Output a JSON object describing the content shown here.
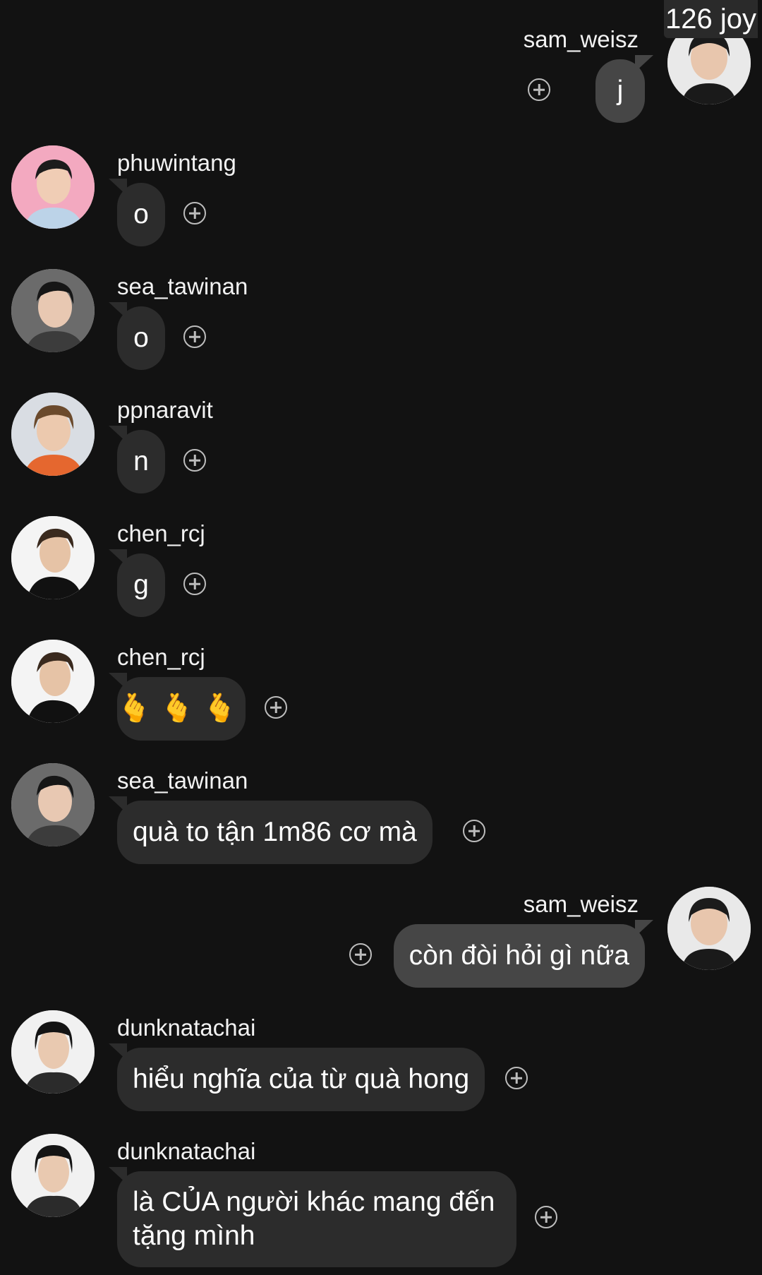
{
  "badge": "126 joy",
  "messages": [
    {
      "user": "sam_weisz",
      "text": "j",
      "side": "right"
    },
    {
      "user": "phuwintang",
      "text": "o",
      "side": "left"
    },
    {
      "user": "sea_tawinan",
      "text": "o",
      "side": "left"
    },
    {
      "user": "ppnaravit",
      "text": "n",
      "side": "left"
    },
    {
      "user": "chen_rcj",
      "text": "g",
      "side": "left"
    },
    {
      "user": "chen_rcj",
      "text": "🫰🫰🫰",
      "side": "left"
    },
    {
      "user": "sea_tawinan",
      "text": "quà to tận 1m86 cơ mà",
      "side": "left"
    },
    {
      "user": "sam_weisz",
      "text": "còn đòi hỏi gì nữa",
      "side": "right"
    },
    {
      "user": "dunknatachai",
      "text": "hiểu nghĩa của từ quà hong",
      "side": "left"
    },
    {
      "user": "dunknatachai",
      "text": "là CỦA người khác mang đến tặng mình",
      "side": "left"
    }
  ],
  "icons": {
    "react": "add-reaction-icon"
  },
  "colors": {
    "background": "#121212",
    "bubble_received": "#2c2c2c",
    "bubble_sent": "#464646"
  }
}
